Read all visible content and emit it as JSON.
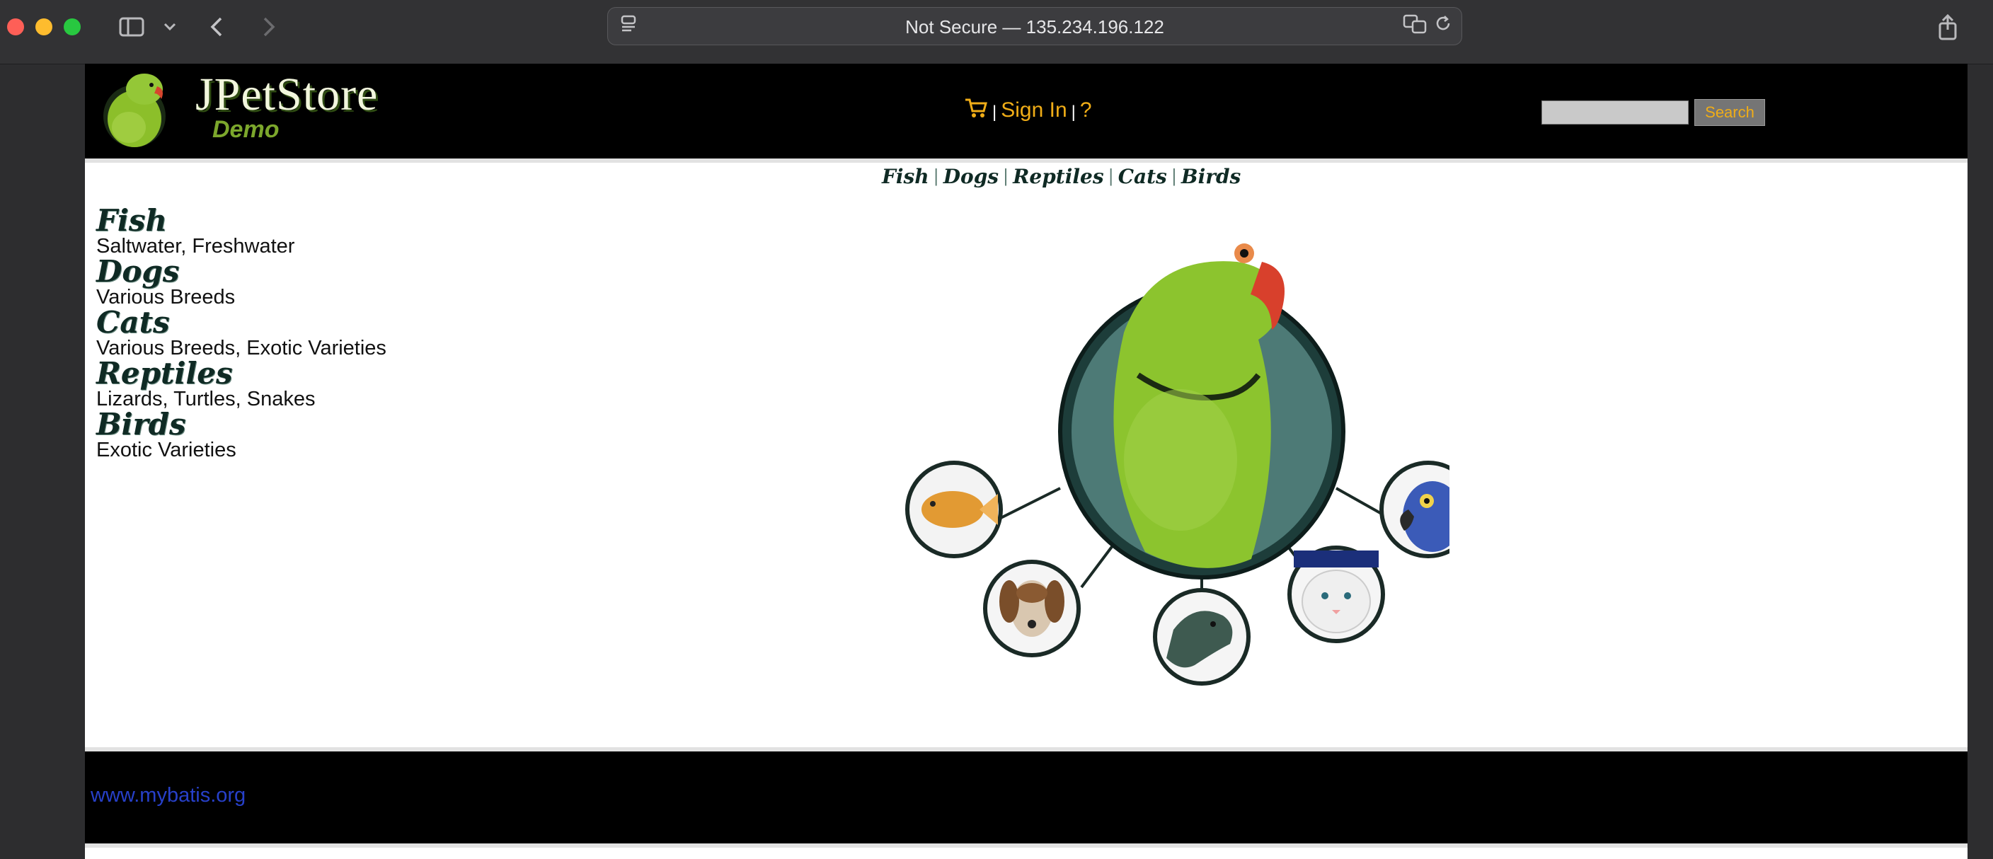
{
  "browser": {
    "address": "Not Secure — 135.234.196.122"
  },
  "header": {
    "logo_title": "JPetStore",
    "logo_subtitle": "Demo",
    "sign_in": "Sign In",
    "separator": "|",
    "help": "?",
    "search_button": "Search",
    "search_value": ""
  },
  "quicklinks": [
    {
      "label": "Fish"
    },
    {
      "label": "Dogs"
    },
    {
      "label": "Reptiles"
    },
    {
      "label": "Cats"
    },
    {
      "label": "Birds"
    }
  ],
  "categories": [
    {
      "title": "Fish",
      "desc": "Saltwater, Freshwater"
    },
    {
      "title": "Dogs",
      "desc": "Various Breeds"
    },
    {
      "title": "Cats",
      "desc": "Various Breeds, Exotic Varieties"
    },
    {
      "title": "Reptiles",
      "desc": "Lizards, Turtles, Snakes"
    },
    {
      "title": "Birds",
      "desc": "Exotic Varieties"
    }
  ],
  "footer": {
    "link": "www.mybatis.org"
  },
  "colors": {
    "accent_orange": "#f0ad17",
    "link_blue": "#2740c9",
    "header_bg": "#000000"
  }
}
